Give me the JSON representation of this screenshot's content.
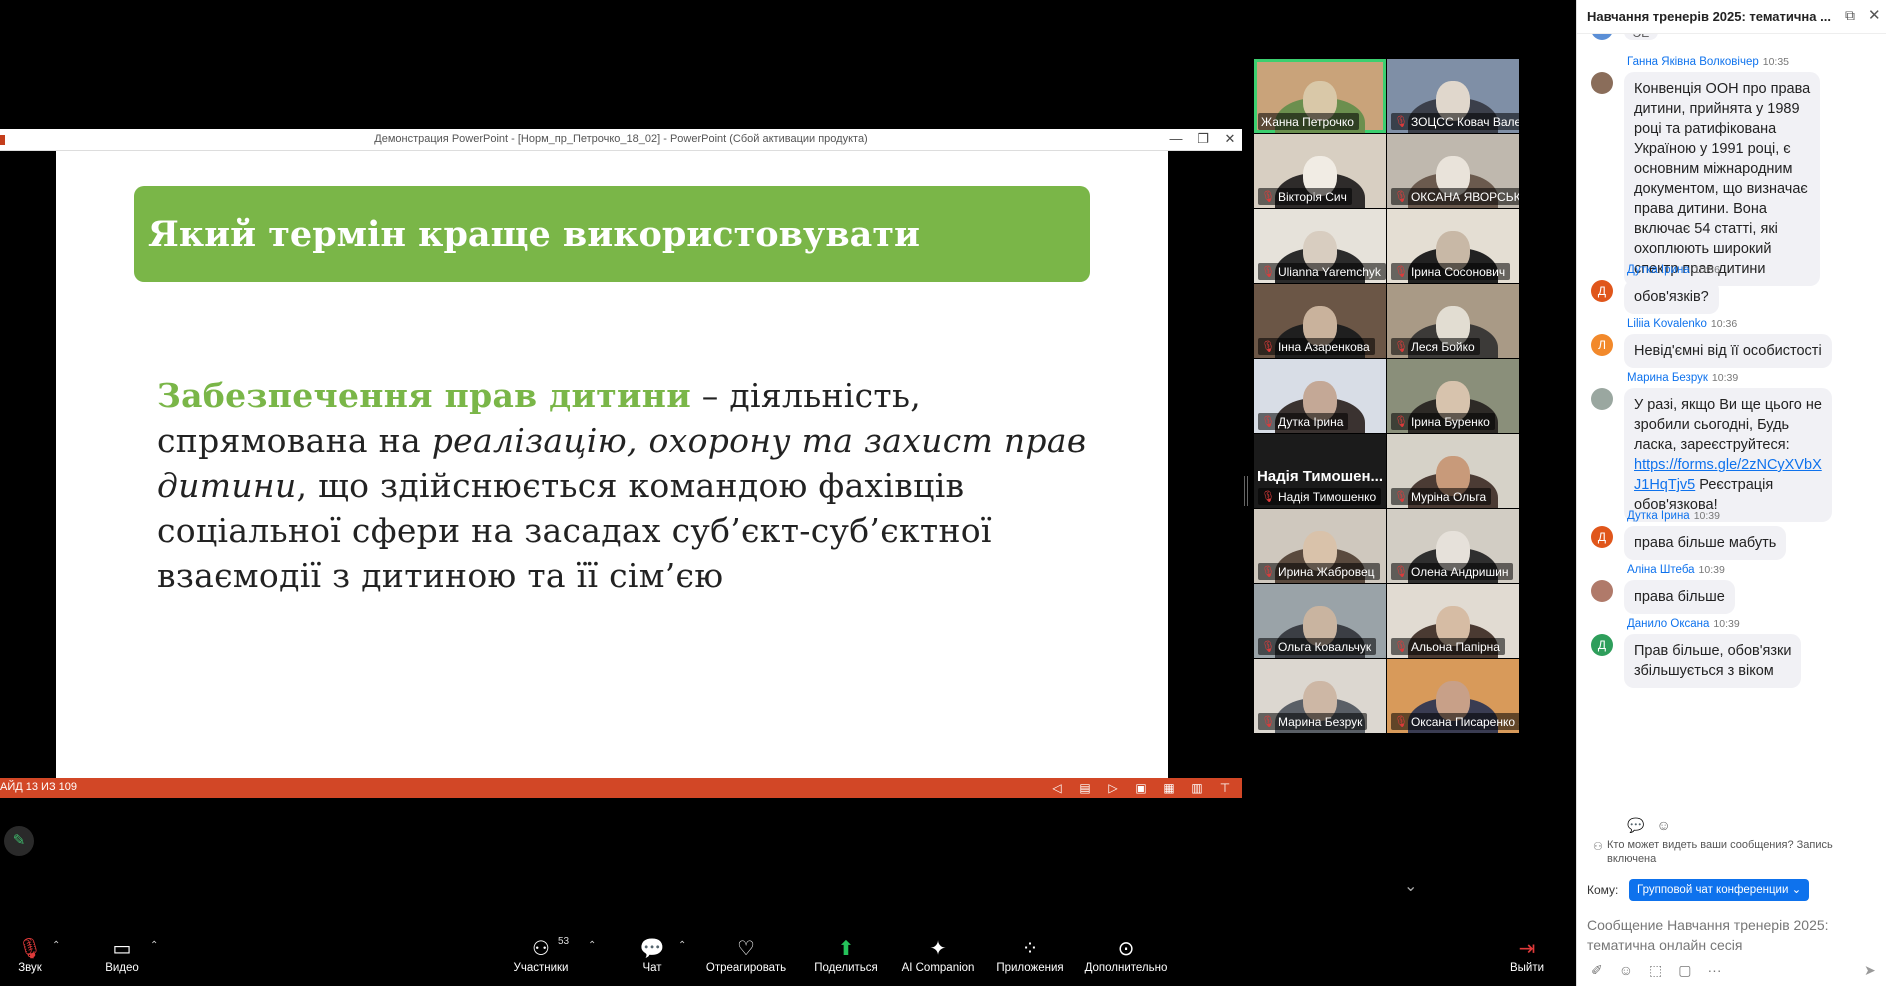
{
  "ppt": {
    "window_title": "Демонстрация PowerPoint - [Норм_пр_Петрочко_18_02] - PowerPoint (Сбой активации продукта)",
    "minimize": "—",
    "restore": "❐",
    "close": "✕",
    "slide_counter": "АЙД 13 ИЗ 109"
  },
  "slide": {
    "heading": "Який термін краще використовувати",
    "term": "Забезпечення прав дитини",
    "text_1": " – діяльність, спрямована на ",
    "italic": "реалізацію, охорону та захист прав дитини",
    "text_2": ", що здійснюється командою фахівців соціальної сфери на засадах суб’єкт-суб’єктної взаємодії з дитиною та її сім’єю"
  },
  "gallery": {
    "participants": [
      {
        "name": "Жанна Петрочко",
        "muted": false,
        "active": true
      },
      {
        "name": "ЗОЦСС Ковач Вален...",
        "muted": true
      },
      {
        "name": "Вікторія Сич",
        "muted": true
      },
      {
        "name": "ОКСАНА ЯВОРСЬКА",
        "muted": true
      },
      {
        "name": "Ulianna Yaremchyk",
        "muted": true
      },
      {
        "name": "Ірина Сосонович",
        "muted": true
      },
      {
        "name": "Інна Азаренкова",
        "muted": true
      },
      {
        "name": "Леся Бойко",
        "muted": true
      },
      {
        "name": "Дутка Ірина",
        "muted": true
      },
      {
        "name": "Ірина Буренко",
        "muted": true
      },
      {
        "name": "Надія Тимошенко",
        "muted": true,
        "no_video_label": "Надія  Тимошен..."
      },
      {
        "name": "Муріна Ольга",
        "muted": true
      },
      {
        "name": "Ирина Жабровец",
        "muted": true
      },
      {
        "name": "Олена Андришин",
        "muted": true
      },
      {
        "name": "Ольга Ковальчук",
        "muted": true
      },
      {
        "name": "Альона Папірна",
        "muted": true
      },
      {
        "name": "Марина Безрук",
        "muted": true
      },
      {
        "name": "Оксана Писаренко З...",
        "muted": true
      }
    ],
    "more_icon": "chevron-down"
  },
  "chat": {
    "title": "Навчання тренерів 2025: тематична ...",
    "partial_top": "ЭЕ",
    "messages": [
      {
        "sender": "Ганна Яківна Волковічер",
        "time": "10:35",
        "avatar": "",
        "avatar_color": "#8a6d5a",
        "lines": [
          "Конвенція ООН про права",
          "дитини, прийнята у 1989",
          "році та ратифікована",
          "Україною у 1991 році, є",
          "основним міжнародним",
          "документом, що визначає",
          "права дитини. Вона",
          "включає 54 статті, які",
          "охоплюють широкий",
          "спектр прав дитини"
        ]
      },
      {
        "sender": "Дутка Ірина",
        "time": "10:36",
        "avatar": "Д",
        "avatar_color": "#e0561b",
        "lines": [
          "обов'язків?"
        ]
      },
      {
        "sender": "Liliia Kovalenko",
        "time": "10:36",
        "avatar": "Л",
        "avatar_color": "#f2892b",
        "lines": [
          "Невід'ємні від її особистості"
        ]
      },
      {
        "sender": "Марина Безрук",
        "time": "10:39",
        "avatar": "",
        "avatar_color": "#9aa7a0",
        "lines": [
          "У разі, якщо Ви ще цього не",
          "зробили сьогодні, Будь",
          "ласка, зареєструйтеся:"
        ],
        "link_1": "https://forms.gle/2zNCyXVbX",
        "link_2": "J1HqTjv5",
        "after_link": " Реєстрація",
        "last_line": "обов'язкова!"
      },
      {
        "sender": "Дутка Ірина",
        "time": "10:39",
        "avatar": "Д",
        "avatar_color": "#e0561b",
        "lines": [
          "права більше мабуть"
        ]
      },
      {
        "sender": "Аліна Штеба",
        "time": "10:39",
        "avatar": "",
        "avatar_color": "#b07a6a",
        "lines": [
          "права більше"
        ]
      },
      {
        "sender": "Данило Оксана",
        "time": "10:39",
        "avatar": "Д",
        "avatar_color": "#2e9e5b",
        "lines": [
          "Прав більше, обов'язки",
          "збільшується з віком"
        ]
      }
    ],
    "who_can_see": "Кто может видеть ваши сообщения? Запись включена",
    "to_label": "Кому:",
    "to_value": "Групповой чат конференции ⌄",
    "input_placeholder": "Сообщение Навчання тренерів 2025: тематична онлайн сесія"
  },
  "toolbar": {
    "audio": "Звук",
    "video": "Видео",
    "participants": "Участники",
    "participants_count": "53",
    "chat": "Чат",
    "react": "Отреагировать",
    "share": "Поделиться",
    "ai": "AI Companion",
    "apps": "Приложения",
    "more": "Дополнительно",
    "leave": "Выйти"
  }
}
